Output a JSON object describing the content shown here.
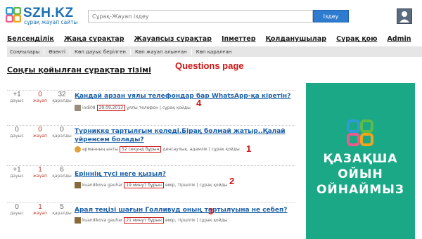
{
  "header": {
    "logo_text": "SZH.KZ",
    "logo_sub": "сұрақ жауап сайты",
    "search_placeholder": "Сұрақ-Жауап іздеу",
    "search_button": "Іздеу",
    "user_icon": "user-icon"
  },
  "main_nav": [
    "Белсенділік",
    "Жаңа сұрақтар",
    "Жауапсыз сұрақтар",
    "Іпметтер",
    "Қолданушылар",
    "Сұрақ қою",
    "Admin"
  ],
  "sub_nav": [
    "Соңғылары",
    "Өзекті",
    "Көп дауыс берілген",
    "Көп жауап алынған",
    "Көп қаралған"
  ],
  "page_title": "Соңғы қойылған сұрақтар тізімі",
  "annotation_label": "Questions page",
  "stat_labels": {
    "votes": "дауыс",
    "answers": "жауап",
    "views": "қаралды"
  },
  "questions": [
    {
      "votes": "+1",
      "answers": "0",
      "views": "32",
      "title": "Қандай арзан ұялы телефондар бар WhatsApp-қа кіретін?",
      "user": "indi08",
      "time": "29.09.2013",
      "tags": "ұялы телефон",
      "action": "сұрақ қойды",
      "number": "4"
    },
    {
      "votes": "0",
      "answers": "0",
      "views": "0",
      "title": "Турникке тартылғым келеді.Бірақ болмай жатыр..Қалай үйренсем болады?",
      "user": "арманның ынты",
      "time": "52 секунд бұрын",
      "tags": "денсаулық, адамлік",
      "action": "сұрақ қойды",
      "number": "1"
    },
    {
      "votes": "+1",
      "answers": "1",
      "views": "6",
      "title": "Еріннің түсі неге қызыл?",
      "user": "kuandikova gauhar",
      "time": "19 минут бұрын",
      "tags": "өмір, тіршілік",
      "action": "сұрақ қойды",
      "number": "2"
    },
    {
      "votes": "0",
      "answers": "1",
      "views": "5",
      "title": "Арал теңізі шағын Голливуд оның тартылуына не себеп?",
      "user": "kuandikova gauhar",
      "time": "21 минут бұрын",
      "tags": "өмір, тіршілік",
      "action": "сұрақ қойды",
      "number": "3"
    }
  ],
  "ad": {
    "line1": "ҚАЗАҚША",
    "line2": "ОЙЫН",
    "line3": "ОЙНАЙМЫЗ"
  },
  "colors": {
    "brand": "#1a6fb5",
    "link": "#1a5fa8",
    "ad_bg": "#1aa886",
    "highlight": "#d21414",
    "answers": "#c0392b"
  }
}
